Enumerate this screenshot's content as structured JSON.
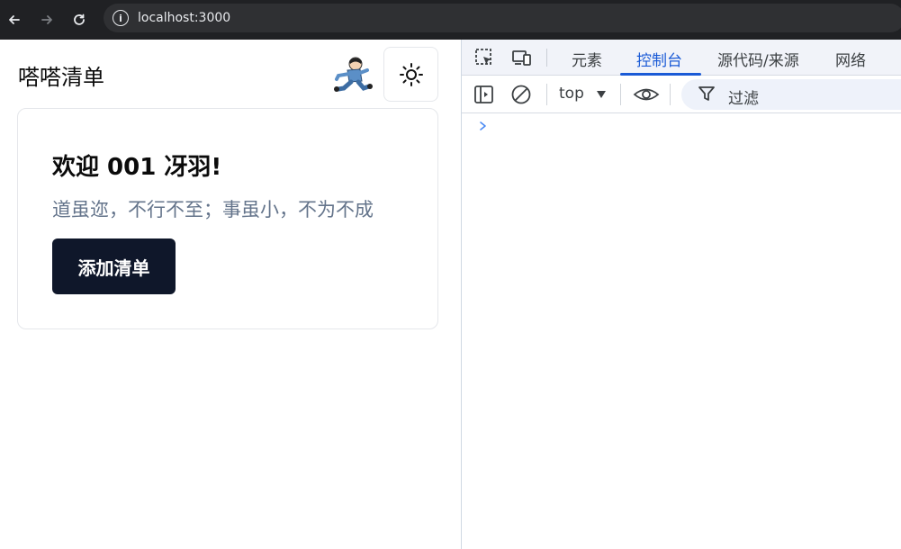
{
  "browser": {
    "url": "localhost:3000",
    "back_icon": "arrow-left-icon",
    "forward_icon": "arrow-right-icon",
    "reload_icon": "reload-icon",
    "info_icon": "site-info-icon"
  },
  "app": {
    "title": "嗒嗒清单",
    "avatar_icon": "running-cartoon-avatar",
    "theme_icon": "sun-icon",
    "card": {
      "title": "欢迎 001 冴羽!",
      "subtitle": "道虽迩，不行不至；事虽小，不为不成",
      "button_label": "添加清单"
    },
    "colors": {
      "button_bg": "#0f172a",
      "subtitle": "#64748b"
    }
  },
  "devtools": {
    "tabs": [
      {
        "label": "元素",
        "active": false
      },
      {
        "label": "控制台",
        "active": true
      },
      {
        "label": "源代码/来源",
        "active": false
      },
      {
        "label": "网络",
        "active": false
      }
    ],
    "context_label": "top",
    "filter_label": "过滤",
    "accent": "#1a5ad6"
  }
}
